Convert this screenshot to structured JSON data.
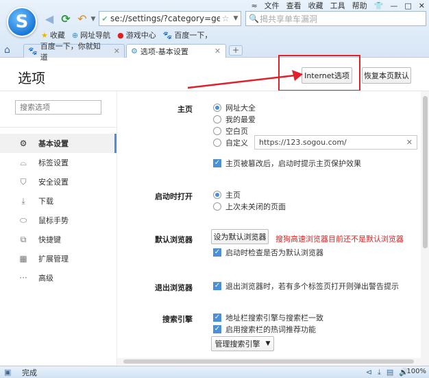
{
  "browser": {
    "top_menu": [
      "文件",
      "查看",
      "收藏",
      "工具",
      "帮助"
    ],
    "address_url": "se://settings/?category=gen",
    "search_placeholder": "揭共享单车漏洞",
    "bookmarks": [
      "收藏",
      "网址导航",
      "游戏中心",
      "百度一下，"
    ],
    "tabs": [
      {
        "label": "百度一下，你就知道",
        "active": false
      },
      {
        "label": "选项-基本设置",
        "active": true
      }
    ],
    "new_tab_label": "+"
  },
  "page": {
    "title": "选项",
    "internet_options_label": "Internet选项",
    "restore_label": "恢复本页默认"
  },
  "sidebar": {
    "search_placeholder": "搜索选项",
    "items": [
      {
        "label": "基本设置",
        "icon": "gear-icon",
        "active": true
      },
      {
        "label": "标签设置",
        "icon": "tab-icon",
        "active": false
      },
      {
        "label": "安全设置",
        "icon": "shield-icon",
        "active": false
      },
      {
        "label": "下载",
        "icon": "download-icon",
        "active": false
      },
      {
        "label": "鼠标手势",
        "icon": "mouse-icon",
        "active": false
      },
      {
        "label": "快捷键",
        "icon": "shortcut-icon",
        "active": false
      },
      {
        "label": "扩展管理",
        "icon": "extension-icon",
        "active": false
      },
      {
        "label": "高级",
        "icon": "more-icon",
        "active": false
      }
    ]
  },
  "settings": {
    "homepage": {
      "label": "主页",
      "options": [
        "网址大全",
        "我的最爱",
        "空白页",
        "自定义"
      ],
      "selected": 0,
      "custom_url": "https://123.sogou.com/",
      "protect_label": "主页被篡改后，启动时提示主页保护效果",
      "protect_checked": true
    },
    "startup": {
      "label": "启动时打开",
      "options": [
        "主页",
        "上次未关闭的页面"
      ],
      "selected": 0
    },
    "default_browser": {
      "label": "默认浏览器",
      "button_label": "设为默认浏览器",
      "warning": "搜狗高速浏览器目前还不是默认浏览器",
      "check_label": "启动时检查是否为默认浏览器",
      "checked": true
    },
    "exit": {
      "label": "退出浏览器",
      "check_label": "退出浏览器时，若有多个标签页打开则弹出警告提示",
      "checked": true
    },
    "search_engine": {
      "label": "搜索引擎",
      "check1_label": "地址栏搜索引擎与搜索栏一致",
      "check2_label": "启用搜索栏的热词推荐功能",
      "manage_label": "管理搜索引擎"
    }
  },
  "status": {
    "text": "完成",
    "zoom": "100%"
  },
  "colors": {
    "accent": "#4a90d9",
    "annotation_red": "#e0202a",
    "warning_red": "#e02020"
  }
}
